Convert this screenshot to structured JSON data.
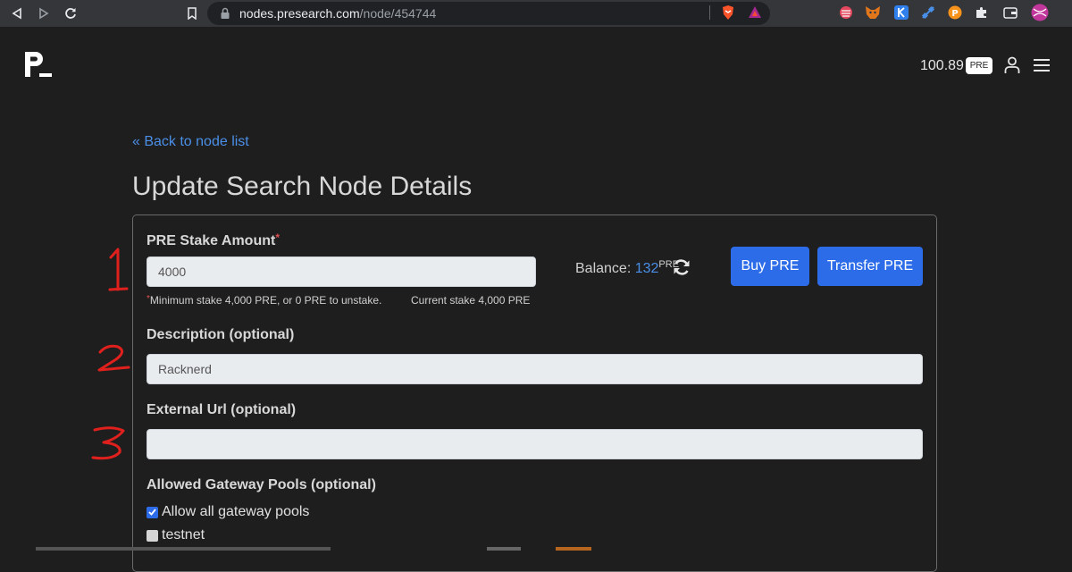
{
  "browser": {
    "url_host": "nodes.presearch.com",
    "url_path": "/node/454744",
    "colors": {
      "chrome": "#35363a",
      "omnibox": "#202124"
    },
    "extensions": [
      "brave-shield-icon",
      "brave-rewards-icon",
      "extension-1-icon",
      "metamask-icon",
      "k-extension-icon",
      "satellite-extension-icon",
      "coin-extension-icon",
      "puzzle-icon",
      "wallet-icon",
      "profile-avatar-icon"
    ]
  },
  "header": {
    "balance": "100.89",
    "badge": "PRE"
  },
  "page": {
    "back_link": "« Back to node list",
    "title": "Update Search Node Details"
  },
  "form": {
    "stake": {
      "label": "PRE Stake Amount",
      "required_mark": "*",
      "value": "4000",
      "hint_min": "Minimum stake 4,000 PRE, or 0 PRE to unstake.",
      "hint_current": "Current stake 4,000 PRE",
      "balance_label": "Balance: ",
      "balance_value": "132",
      "balance_unit": "PRE",
      "buy_button": "Buy PRE",
      "transfer_button": "Transfer PRE"
    },
    "description": {
      "label": "Description (optional)",
      "value": "Racknerd"
    },
    "external_url": {
      "label": "External Url (optional)",
      "value": ""
    },
    "gateway_pools": {
      "label": "Allowed Gateway Pools (optional)",
      "options": [
        {
          "label": "Allow all gateway pools",
          "checked": true
        },
        {
          "label": "testnet",
          "checked": false
        }
      ]
    }
  },
  "annotations": [
    "1",
    "2",
    "3"
  ],
  "colors": {
    "accent": "#2d6ce8",
    "link": "#4a8fe7",
    "required": "#e05050",
    "annotation": "#e0201c",
    "background": "#1e1e1e"
  }
}
